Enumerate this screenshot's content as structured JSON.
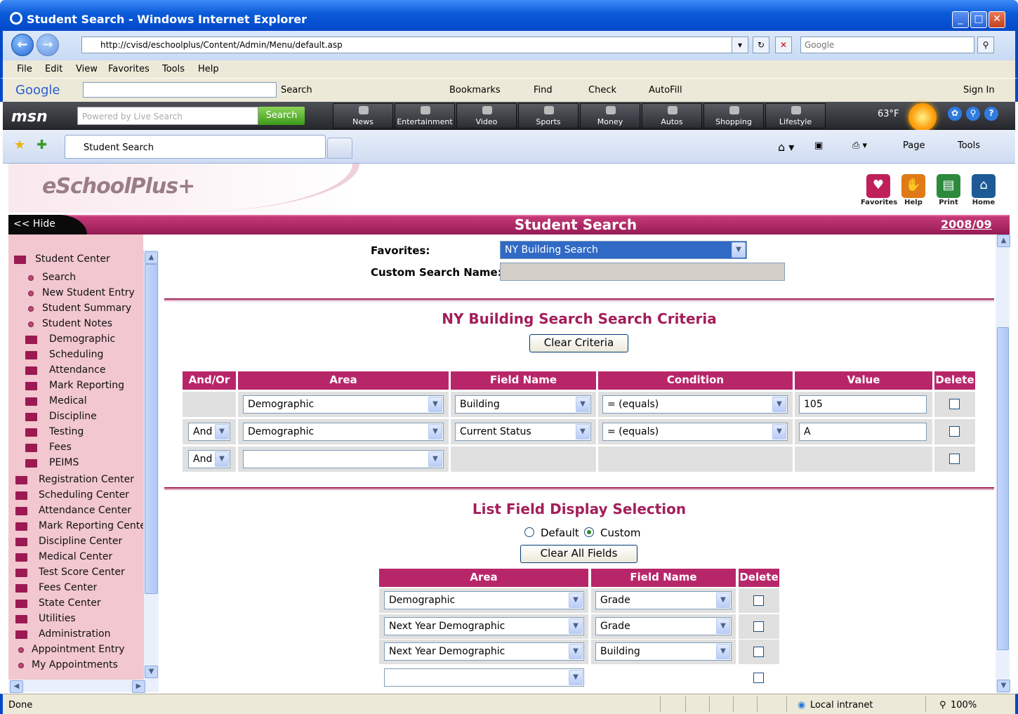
{
  "window": {
    "title": "Student Search - Windows Internet Explorer",
    "minimize": "_",
    "maximize": "□",
    "close": "✕"
  },
  "address": {
    "url": "http://cvisd/eschoolplus/Content/Admin/Menu/default.asp",
    "search_placeholder": "Google"
  },
  "menu": [
    "File",
    "Edit",
    "View",
    "Favorites",
    "Tools",
    "Help"
  ],
  "google_toolbar": {
    "logo": "Google",
    "search": "Search",
    "bookmarks": "Bookmarks",
    "find": "Find",
    "check": "Check",
    "autofill": "AutoFill",
    "sign_in": "Sign In"
  },
  "msn": {
    "logo": "msn",
    "search_placeholder": "Powered by Live Search",
    "search_btn": "Search",
    "tabs": [
      "News",
      "Entertainment",
      "Video",
      "Sports",
      "Money",
      "Autos",
      "Shopping",
      "Lifestyle"
    ],
    "temp": "63°F"
  },
  "tabs": {
    "active": "Student Search",
    "page": "Page",
    "tools": "Tools"
  },
  "app": {
    "logo": "eSchoolPlus+",
    "icons": [
      "Favorites",
      "Help",
      "Print",
      "Home"
    ],
    "hide": "<< Hide",
    "page_title": "Student Search",
    "year": "2008/09"
  },
  "sidebar": {
    "items": [
      "Student Center",
      "Search",
      "New Student Entry",
      "Student Summary",
      "Student Notes",
      "Demographic",
      "Scheduling",
      "Attendance",
      "Mark Reporting",
      "Medical",
      "Discipline",
      "Testing",
      "Fees",
      "PEIMS",
      "Registration Center",
      "Scheduling Center",
      "Attendance Center",
      "Mark Reporting Center",
      "Discipline Center",
      "Medical Center",
      "Test Score Center",
      "Fees Center",
      "State Center",
      "Utilities",
      "Administration",
      "Appointment Entry",
      "My Appointments"
    ]
  },
  "favorites": {
    "label": "Favorites:",
    "value": "NY Building Search",
    "custom_label": "Custom Search Name:",
    "custom_value": ""
  },
  "criteria": {
    "title": "NY Building Search Search Criteria",
    "clear": "Clear Criteria",
    "headers": [
      "And/Or",
      "Area",
      "Field Name",
      "Condition",
      "Value",
      "Delete"
    ],
    "rows": [
      {
        "andor": "",
        "area": "Demographic",
        "field": "Building",
        "cond": "= (equals)",
        "value": "105"
      },
      {
        "andor": "And",
        "area": "Demographic",
        "field": "Current Status",
        "cond": "= (equals)",
        "value": "A"
      },
      {
        "andor": "And",
        "area": "",
        "field": "",
        "cond": "",
        "value": ""
      }
    ]
  },
  "display": {
    "title": "List Field Display Selection",
    "default": "Default",
    "custom": "Custom",
    "selected": "Custom",
    "clear": "Clear All Fields",
    "headers": [
      "Area",
      "Field Name",
      "Delete"
    ],
    "rows": [
      {
        "area": "Demographic",
        "field": "Grade"
      },
      {
        "area": "Next Year Demographic",
        "field": "Grade"
      },
      {
        "area": "Next Year Demographic",
        "field": "Building"
      },
      {
        "area": "",
        "field": ""
      }
    ]
  },
  "status": {
    "text": "Done",
    "zone": "Local intranet",
    "zoom": "100%"
  }
}
